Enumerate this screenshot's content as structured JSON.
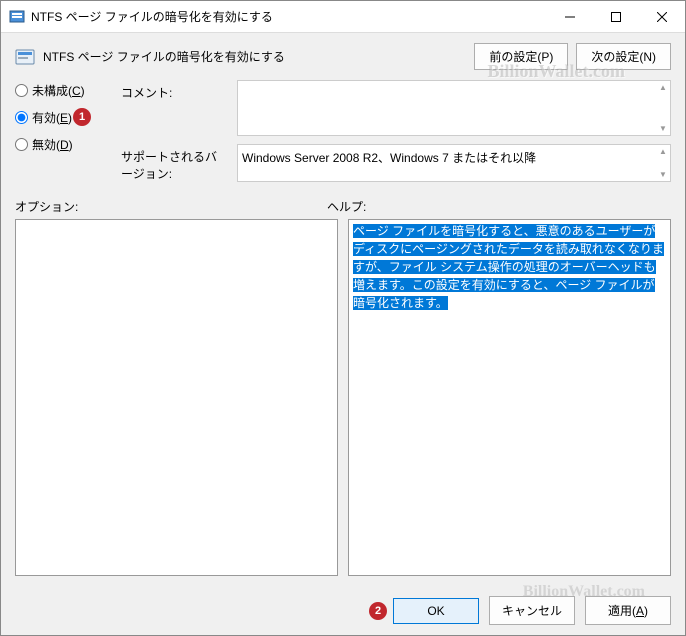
{
  "titlebar": {
    "title": "NTFS ページ ファイルの暗号化を有効にする"
  },
  "header": {
    "title": "NTFS ページ ファイルの暗号化を有効にする",
    "prev_button": "前の設定(P)",
    "next_button": "次の設定(N)"
  },
  "radio": {
    "not_configured": "未構成(C)",
    "enabled": "有効(E)",
    "disabled": "無効(D)",
    "selected": "enabled"
  },
  "fields": {
    "comment_label": "コメント:",
    "comment_value": "",
    "supported_label": "サポートされるバージョン:",
    "supported_value": "Windows Server 2008 R2、Windows 7 またはそれ以降"
  },
  "sections": {
    "options_label": "オプション:",
    "help_label": "ヘルプ:"
  },
  "help": {
    "text": "ページ ファイルを暗号化すると、悪意のあるユーザーがディスクにページングされたデータを読み取れなくなりますが、ファイル システム操作の処理のオーバーヘッドも増えます。この設定を有効にすると、ページ ファイルが暗号化されます。"
  },
  "footer": {
    "ok": "OK",
    "cancel": "キャンセル",
    "apply": "適用(A)"
  },
  "markers": {
    "one": "1",
    "two": "2"
  },
  "watermark": "BillionWallet.com"
}
